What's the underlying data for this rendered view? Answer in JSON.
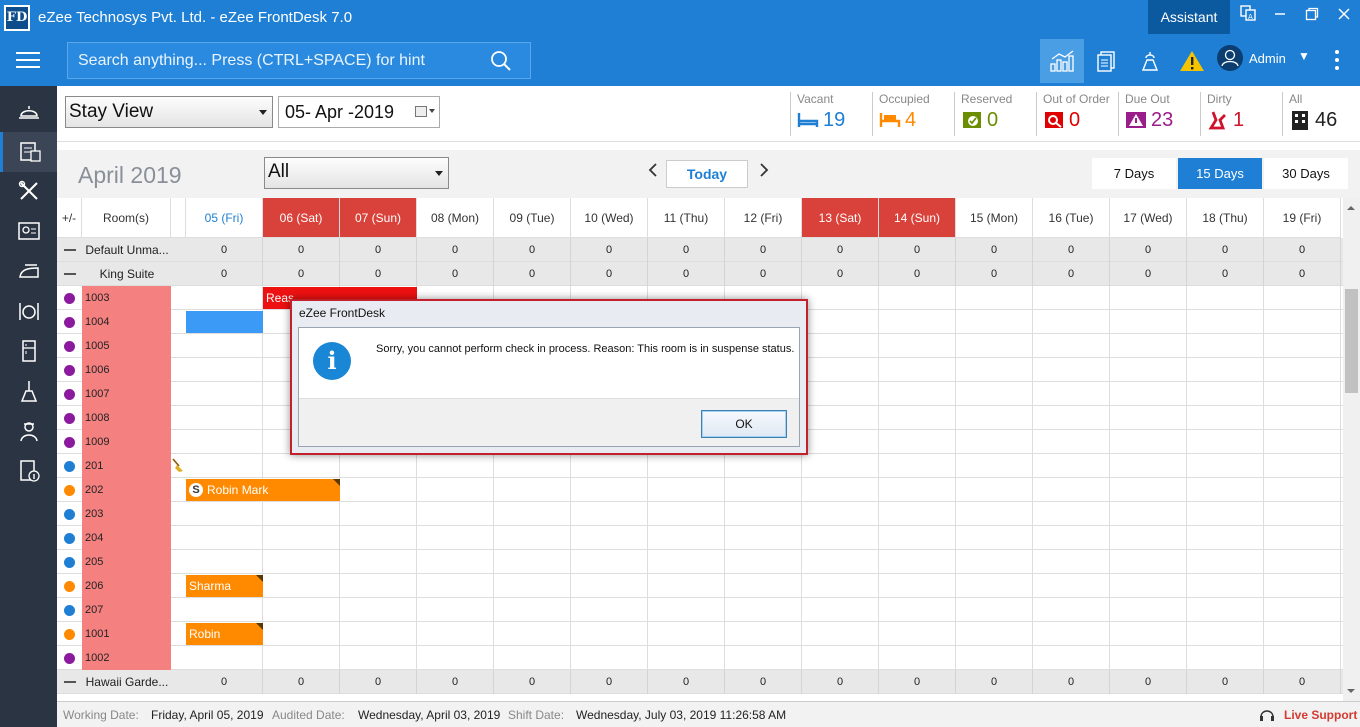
{
  "window": {
    "title": "eZee Technosys Pvt. Ltd. - eZee FrontDesk 7.0",
    "logo": "FD",
    "assistant_label": "Assistant"
  },
  "topbar": {
    "search_placeholder": "Search anything... Press (CTRL+SPACE) for hint",
    "user_name": "Admin"
  },
  "controls": {
    "view_select": "Stay View",
    "date": "05- Apr -2019",
    "stats": [
      {
        "label": "Vacant",
        "value": "19",
        "color": "#1e7fd4",
        "icon": "bed-icon"
      },
      {
        "label": "Occupied",
        "value": "4",
        "color": "#ff8a00",
        "icon": "occupied-bed-icon"
      },
      {
        "label": "Reserved",
        "value": "0",
        "color": "#6b8e00",
        "icon": "reserved-icon"
      },
      {
        "label": "Out of Order",
        "value": "0",
        "color": "#e00000",
        "icon": "out-of-order-icon"
      },
      {
        "label": "Due Out",
        "value": "23",
        "color": "#9b1d8a",
        "icon": "due-out-icon"
      },
      {
        "label": "Dirty",
        "value": "1",
        "color": "#d0132c",
        "icon": "dirty-icon"
      },
      {
        "label": "All",
        "value": "46",
        "color": "#222222",
        "icon": "building-icon"
      }
    ]
  },
  "calendar": {
    "month": "April 2019",
    "room_type": "All",
    "today_label": "Today",
    "ranges": [
      "7 Days",
      "15 Days",
      "30 Days"
    ],
    "active_range": "15 Days",
    "toggle_label": "+/-",
    "rooms_label": "Room(s)",
    "days": [
      {
        "label": "05 (Fri)",
        "type": "current"
      },
      {
        "label": "06 (Sat)",
        "type": "weekend"
      },
      {
        "label": "07 (Sun)",
        "type": "weekend"
      },
      {
        "label": "08 (Mon)",
        "type": "normal"
      },
      {
        "label": "09 (Tue)",
        "type": "normal"
      },
      {
        "label": "10 (Wed)",
        "type": "normal"
      },
      {
        "label": "11 (Thu)",
        "type": "normal"
      },
      {
        "label": "12 (Fri)",
        "type": "normal"
      },
      {
        "label": "13 (Sat)",
        "type": "weekend"
      },
      {
        "label": "14 (Sun)",
        "type": "weekend"
      },
      {
        "label": "15 (Mon)",
        "type": "normal"
      },
      {
        "label": "16 (Tue)",
        "type": "normal"
      },
      {
        "label": "17 (Wed)",
        "type": "normal"
      },
      {
        "label": "18 (Thu)",
        "type": "normal"
      },
      {
        "label": "19 (Fri)",
        "type": "normal"
      }
    ],
    "rows": [
      {
        "kind": "group",
        "name": "Default Unma...",
        "counts": [
          "0",
          "0",
          "0",
          "0",
          "0",
          "0",
          "0",
          "0",
          "0",
          "0",
          "0",
          "0",
          "0",
          "0",
          "0"
        ]
      },
      {
        "kind": "group",
        "name": "King Suite",
        "counts": [
          "0",
          "0",
          "0",
          "0",
          "0",
          "0",
          "0",
          "0",
          "0",
          "0",
          "0",
          "0",
          "0",
          "0",
          "0"
        ]
      },
      {
        "kind": "room",
        "number": "1003",
        "dot": "#8b1a9e"
      },
      {
        "kind": "room",
        "number": "1004",
        "dot": "#8b1a9e"
      },
      {
        "kind": "room",
        "number": "1005",
        "dot": "#8b1a9e"
      },
      {
        "kind": "room",
        "number": "1006",
        "dot": "#8b1a9e"
      },
      {
        "kind": "room",
        "number": "1007",
        "dot": "#8b1a9e"
      },
      {
        "kind": "room",
        "number": "1008",
        "dot": "#8b1a9e"
      },
      {
        "kind": "room",
        "number": "1009",
        "dot": "#8b1a9e"
      },
      {
        "kind": "room",
        "number": "201",
        "dot": "#1e7fd4",
        "dirty": true
      },
      {
        "kind": "room",
        "number": "202",
        "dot": "#ff8a00"
      },
      {
        "kind": "room",
        "number": "203",
        "dot": "#1e7fd4"
      },
      {
        "kind": "room",
        "number": "204",
        "dot": "#1e7fd4"
      },
      {
        "kind": "room",
        "number": "205",
        "dot": "#1e7fd4"
      },
      {
        "kind": "room",
        "number": "206",
        "dot": "#ff8a00"
      },
      {
        "kind": "room",
        "number": "207",
        "dot": "#1e7fd4"
      },
      {
        "kind": "room",
        "number": "1001",
        "dot": "#ff8a00"
      },
      {
        "kind": "room",
        "number": "1002",
        "dot": "#8b1a9e"
      },
      {
        "kind": "group",
        "name": "Hawaii Garde...",
        "counts": [
          "0",
          "0",
          "0",
          "0",
          "0",
          "0",
          "0",
          "0",
          "0",
          "0",
          "0",
          "0",
          "0",
          "0",
          "0"
        ]
      }
    ],
    "bookings": [
      {
        "row": 2,
        "start": 1,
        "span": 2,
        "label": "Reas",
        "color": "red",
        "corner": false
      },
      {
        "row": 3,
        "start": 0,
        "span": 1,
        "label": "",
        "color": "blue",
        "corner": false
      },
      {
        "row": 10,
        "start": 0,
        "span": 2,
        "label": "Robin Mark",
        "color": "orange",
        "corner": true,
        "badge": "S"
      },
      {
        "row": 14,
        "start": 0,
        "span": 1,
        "label": "Sharma",
        "color": "orange",
        "corner": true
      },
      {
        "row": 16,
        "start": 0,
        "span": 1,
        "label": "Robin",
        "color": "orange",
        "corner": true
      }
    ]
  },
  "statusbar": {
    "working_label": "Working Date:",
    "working_value": "Friday, April 05, 2019",
    "audited_label": "Audited Date:",
    "audited_value": "Wednesday, April 03, 2019",
    "shift_label": "Shift Date:",
    "shift_value": "Wednesday, July 03, 2019 11:26:58 AM",
    "live_support": "Live Support"
  },
  "dialog": {
    "title": "eZee FrontDesk",
    "message": "Sorry, you cannot perform check in process. Reason: This room is in suspense status.",
    "ok_label": "OK",
    "icon": "info-icon"
  }
}
